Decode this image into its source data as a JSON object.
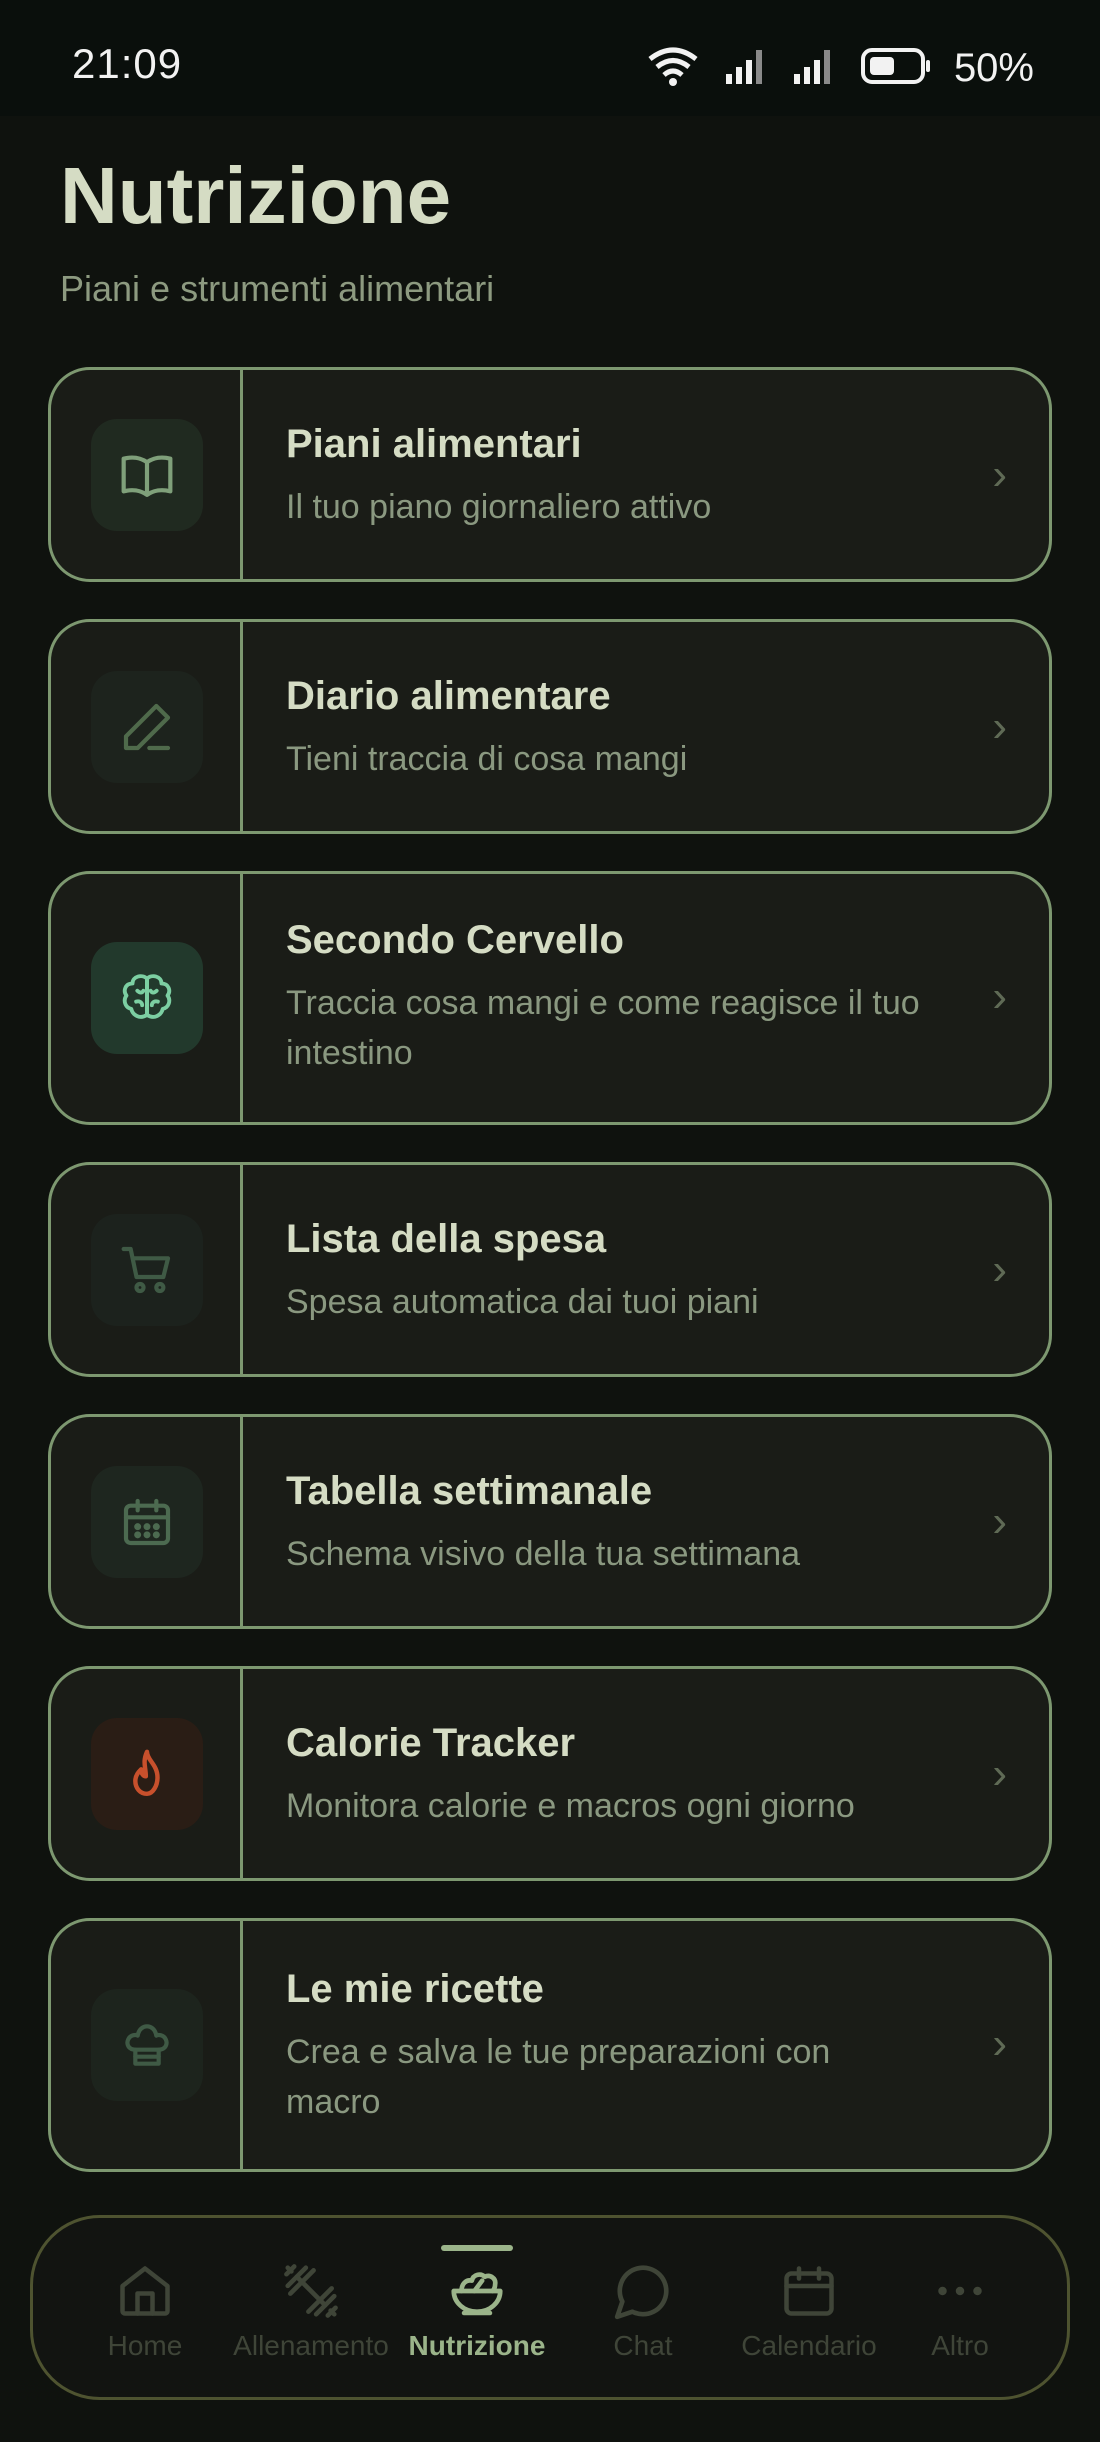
{
  "status_bar": {
    "time": "21:09",
    "battery": "50%"
  },
  "header": {
    "title": "Nutrizione",
    "subtitle": "Piani e strumenti alimentari"
  },
  "menu": [
    {
      "title": "Piani alimentari",
      "desc": "Il tuo piano giornaliero attivo",
      "icon": "book-icon"
    },
    {
      "title": "Diario alimentare",
      "desc": "Tieni traccia di cosa mangi",
      "icon": "pencil-icon"
    },
    {
      "title": "Secondo Cervello",
      "desc": "Traccia cosa mangi e come reagisce il tuo intestino",
      "icon": "brain-icon"
    },
    {
      "title": "Lista della spesa",
      "desc": "Spesa automatica dai tuoi piani",
      "icon": "cart-icon"
    },
    {
      "title": "Tabella settimanale",
      "desc": "Schema visivo della tua settimana",
      "icon": "calendar-icon"
    },
    {
      "title": "Calorie Tracker",
      "desc": "Monitora calorie e macros ogni giorno",
      "icon": "flame-icon"
    },
    {
      "title": "Le mie ricette",
      "desc": "Crea e salva le tue preparazioni con macro",
      "icon": "chef-hat-icon"
    }
  ],
  "nav": [
    {
      "label": "Home",
      "icon": "home-icon"
    },
    {
      "label": "Allenamento",
      "icon": "dumbbell-icon"
    },
    {
      "label": "Nutrizione",
      "icon": "salad-bowl-icon",
      "active": true
    },
    {
      "label": "Chat",
      "icon": "chat-bubble-icon"
    },
    {
      "label": "Calendario",
      "icon": "calendar-icon"
    },
    {
      "label": "Altro",
      "icon": "more-dots-icon"
    }
  ],
  "colors": {
    "background": "#0f120e",
    "card_border": "#7d9870",
    "accent": "#9bb48a",
    "flame": "#c8502c"
  }
}
